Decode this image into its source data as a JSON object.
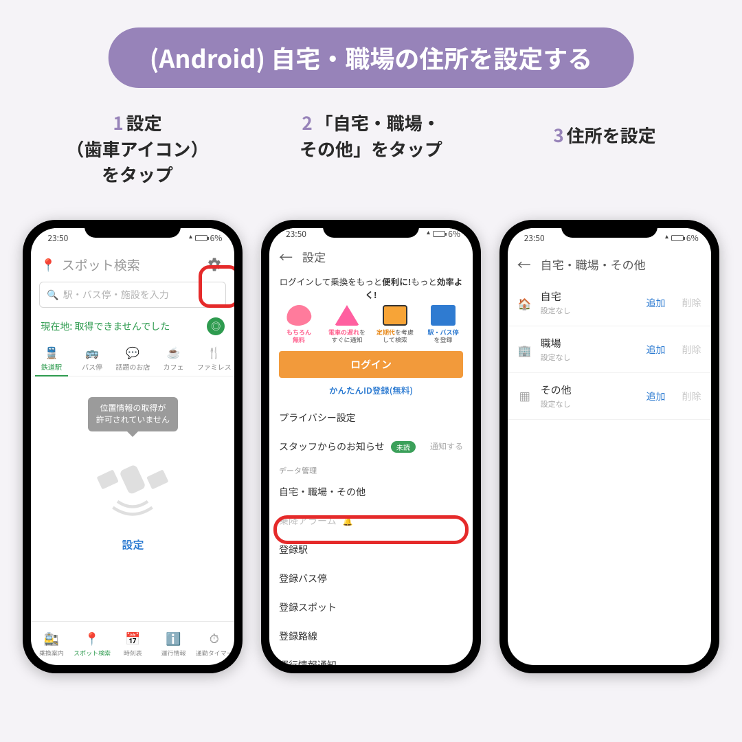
{
  "title": "(Android) 自宅・職場の住所を設定する",
  "steps": {
    "s1": {
      "num": "1",
      "text": "設定\n（歯車アイコン）\nをタップ"
    },
    "s2": {
      "num": "2",
      "text": "「自宅・職場・\nその他」をタップ"
    },
    "s3": {
      "num": "3",
      "text": "住所を設定"
    }
  },
  "status": {
    "time": "23:50",
    "battery": "6%"
  },
  "phone1": {
    "search_title": "スポット検索",
    "search_placeholder": "駅・バス停・施設を入力",
    "loc_fail": "現在地: 取得できませんでした",
    "tabs": [
      "鉄道駅",
      "バス停",
      "話題のお店",
      "カフェ",
      "ファミレス"
    ],
    "bubble_l1": "位置情報の取得が",
    "bubble_l2": "許可されていません",
    "settings_link": "設定",
    "bottom": [
      "乗換案内",
      "スポット検索",
      "時刻表",
      "運行情報",
      "通勤タイマー"
    ]
  },
  "phone2": {
    "header": "設定",
    "promo_head_a": "ログインして乗換をもっと",
    "promo_head_b": "便利に!",
    "promo_head_c": "もっと",
    "promo_head_d": "効率よく!",
    "promo": {
      "free_l1": "もちろん",
      "free_l2": "無料",
      "delay_l1": "電車の遅れを",
      "delay_l2": "すぐに通知",
      "teiki_l1": "定期代を考慮",
      "teiki_l2": "して検索",
      "bus_l1": "駅・バス停",
      "bus_l2": "を登録"
    },
    "login": "ログイン",
    "easy_id": "かんたんID登録(無料)",
    "items": {
      "privacy": "プライバシー設定",
      "staff": "スタッフからのお知らせ",
      "unread": "未読",
      "notify": "通知する",
      "section_data": "データ管理",
      "home_work": "自宅・職場・その他",
      "alarm": "乗降アラーム",
      "reg_station": "登録駅",
      "reg_bus": "登録バス停",
      "reg_spot": "登録スポット",
      "reg_line": "登録路線",
      "service_info": "運行情報通知"
    }
  },
  "phone3": {
    "header": "自宅・職場・その他",
    "rows": [
      {
        "icon": "home",
        "title": "自宅",
        "sub": "設定なし"
      },
      {
        "icon": "work",
        "title": "職場",
        "sub": "設定なし"
      },
      {
        "icon": "other",
        "title": "その他",
        "sub": "設定なし"
      }
    ],
    "add": "追加",
    "del": "削除"
  }
}
